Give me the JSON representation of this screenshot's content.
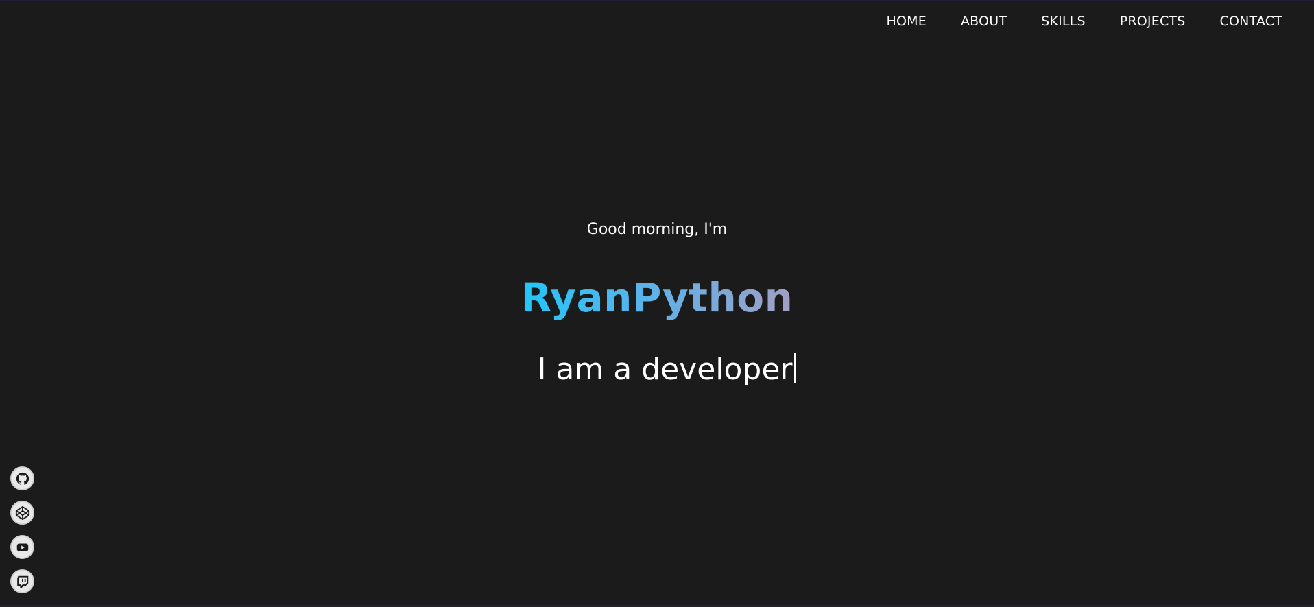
{
  "nav": {
    "items": [
      {
        "label": "HOME"
      },
      {
        "label": "ABOUT"
      },
      {
        "label": "SKILLS"
      },
      {
        "label": "PROJECTS"
      },
      {
        "label": "CONTACT"
      }
    ]
  },
  "hero": {
    "greeting": "Good morning, I'm",
    "name": "RyanPython",
    "tagline": "I am a developer"
  },
  "social": {
    "links": [
      {
        "icon": "github-icon"
      },
      {
        "icon": "codepen-icon"
      },
      {
        "icon": "youtube-icon"
      },
      {
        "icon": "twitch-icon"
      }
    ]
  },
  "colors": {
    "background": "#1b1b1c",
    "name_gradient_start": "#22c6f8",
    "name_gradient_end": "#a29fc4",
    "text": "#ffffff"
  }
}
